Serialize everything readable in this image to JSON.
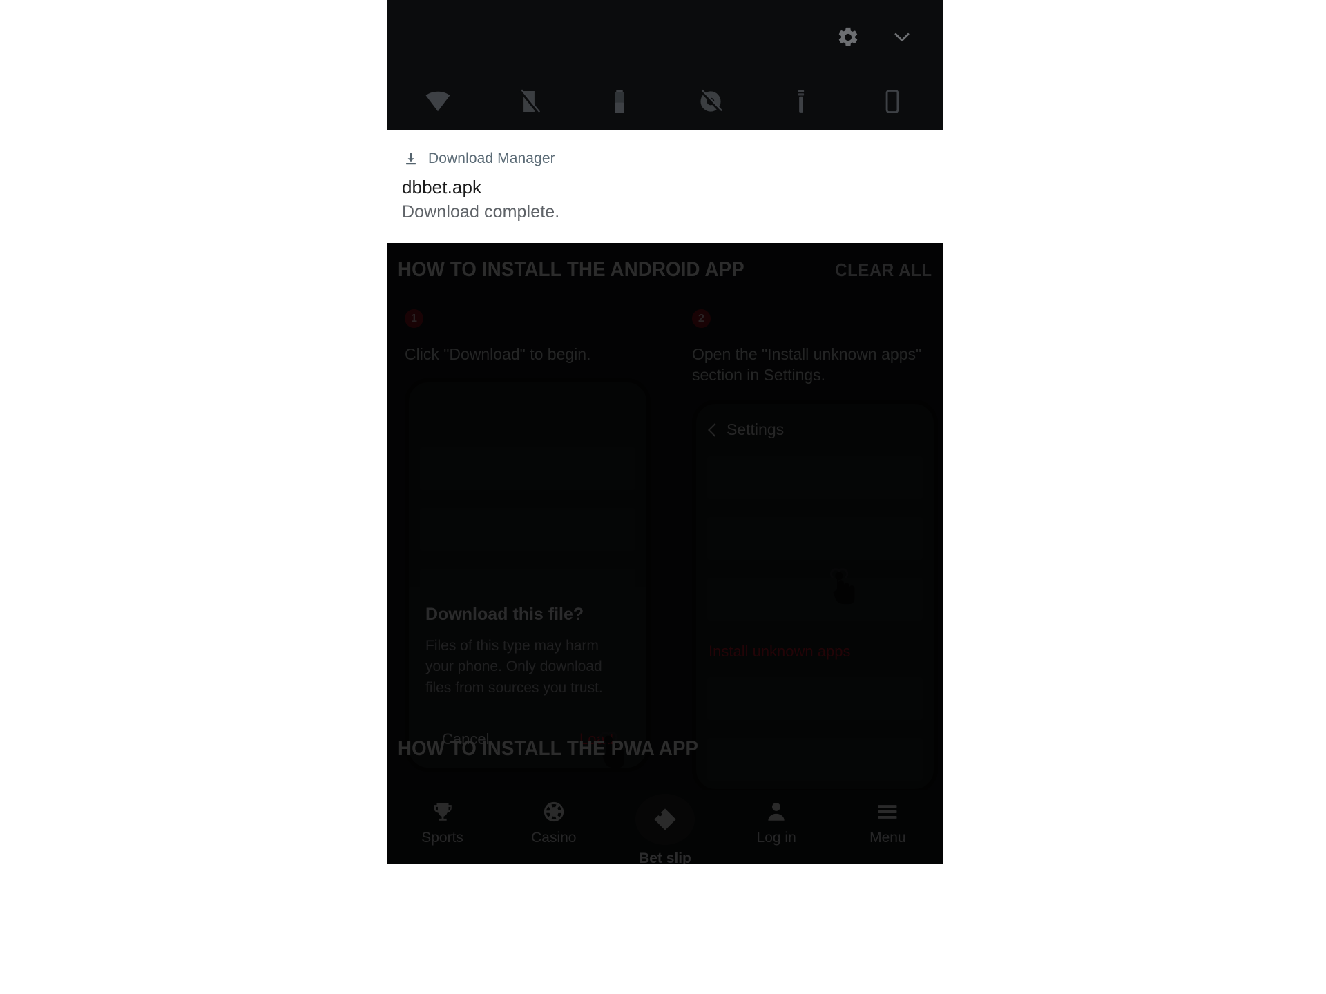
{
  "quick_settings": {
    "gear_icon": "gear-icon",
    "expand_icon": "chevron-down-icon",
    "tiles": [
      {
        "name": "wifi-tile",
        "icon": "wifi-icon"
      },
      {
        "name": "mobile-data-tile",
        "icon": "mobile-data-off-icon"
      },
      {
        "name": "battery-saver-tile",
        "icon": "battery-icon"
      },
      {
        "name": "do-not-disturb-tile",
        "icon": "sound-off-icon"
      },
      {
        "name": "flashlight-tile",
        "icon": "flashlight-icon"
      },
      {
        "name": "auto-rotate-tile",
        "icon": "phone-rotate-icon"
      }
    ]
  },
  "notification": {
    "app_icon": "download-icon",
    "app_name": "Download Manager",
    "title": "dbbet.apk",
    "subtitle": "Download complete."
  },
  "page": {
    "android_section": {
      "title": "HOW TO INSTALL THE ANDROID APP",
      "clear_all": "CLEAR ALL",
      "steps": [
        {
          "number": "1",
          "text": "Click \"Download\" to begin.",
          "mock": {
            "dialog": {
              "title": "Download this file?",
              "body": "Files of this type may harm your phone. Only download files from sources you trust.",
              "cancel_label": "Cancel",
              "load_label": "Load"
            }
          }
        },
        {
          "number": "2",
          "text": "Open the \"Install unknown apps\" section in Settings.",
          "mock": {
            "settings_label": "Settings",
            "unknown_apps_label": "Install unknown apps"
          }
        }
      ]
    },
    "pwa_section": {
      "title": "HOW TO INSTALL THE PWA APP"
    },
    "bottom_nav": [
      {
        "label": "Sports",
        "icon": "trophy-icon",
        "featured": false
      },
      {
        "label": "Casino",
        "icon": "casino-chip-icon",
        "featured": false
      },
      {
        "label": "Bet slip",
        "icon": "diamond-icon",
        "featured": true
      },
      {
        "label": "Log in",
        "icon": "person-icon",
        "featured": false
      },
      {
        "label": "Menu",
        "icon": "hamburger-icon",
        "featured": false
      }
    ]
  },
  "colors": {
    "accent_red": "#c3192b",
    "panel_black": "#0b0c0d",
    "page_dark": "#141516",
    "notif_app_blue_gray": "#5b6b76"
  }
}
